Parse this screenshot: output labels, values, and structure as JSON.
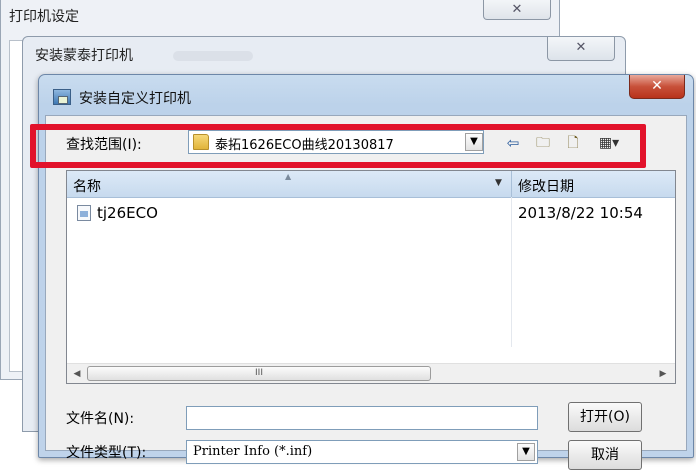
{
  "window1": {
    "title": "打印机设定",
    "close_glyph": "✕"
  },
  "window2": {
    "title": "安装蒙泰打印机",
    "close_glyph": "✕"
  },
  "dialog": {
    "title": "安装自定义打印机",
    "close_glyph": "✕",
    "look_in_label": "查找范围(I):",
    "look_in_value": "泰拓1626ECO曲线20130817",
    "toolbar": {
      "back_icon": "back-arrow-icon",
      "up_icon": "up-folder-icon",
      "new_folder_icon": "new-folder-icon",
      "view_menu_icon": "view-menu-icon"
    },
    "file_list": {
      "columns": [
        "名称",
        "修改日期"
      ],
      "rows": [
        {
          "name": "tj26ECO",
          "modified": "2013/8/22 10:54"
        }
      ],
      "scroll_thumb": "III"
    },
    "file_name_label": "文件名(N):",
    "file_name_value": "",
    "file_type_label": "文件类型(T):",
    "file_type_value": "Printer Info (*.inf)",
    "open_button": "打开(O)",
    "cancel_button": "取消",
    "highlight_color": "#e2122b"
  }
}
